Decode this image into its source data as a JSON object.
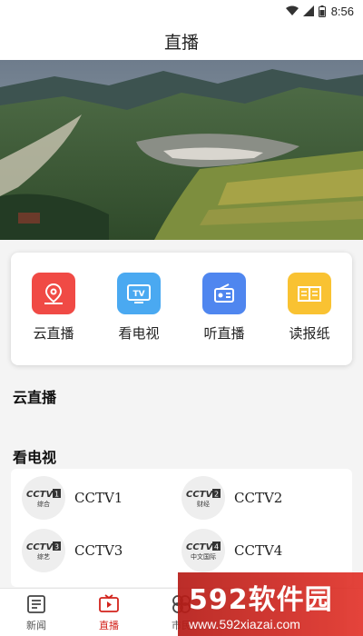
{
  "status_bar": {
    "time": "8:56"
  },
  "header": {
    "title": "直播"
  },
  "quick_actions": [
    {
      "label": "云直播",
      "icon": "location-pin-icon",
      "color": "#f04a45"
    },
    {
      "label": "看电视",
      "icon": "tv-icon",
      "color": "#4aa9f1"
    },
    {
      "label": "听直播",
      "icon": "radio-icon",
      "color": "#4f86ef"
    },
    {
      "label": "读报纸",
      "icon": "newspaper-icon",
      "color": "#f9c232"
    }
  ],
  "sections": {
    "cloud_live": "云直播",
    "watch_tv": "看电视"
  },
  "channels": [
    {
      "name": "CCTV1",
      "logo_sub": "综合"
    },
    {
      "name": "CCTV2",
      "logo_sub": "财经"
    },
    {
      "name": "CCTV3",
      "logo_sub": "综艺"
    },
    {
      "name": "CCTV4",
      "logo_sub": "中文国际"
    }
  ],
  "bottom_nav": [
    {
      "label": "新闻",
      "icon": "news-icon"
    },
    {
      "label": "直播",
      "icon": "live-tv-icon"
    },
    {
      "label": "市民",
      "icon": "citizen-icon"
    },
    {
      "label": "",
      "icon": ""
    },
    {
      "label": "",
      "icon": ""
    }
  ],
  "watermark": {
    "main": "592软件园",
    "url": "www.592xiazai.com"
  },
  "colors": {
    "accent": "#d3231c"
  }
}
